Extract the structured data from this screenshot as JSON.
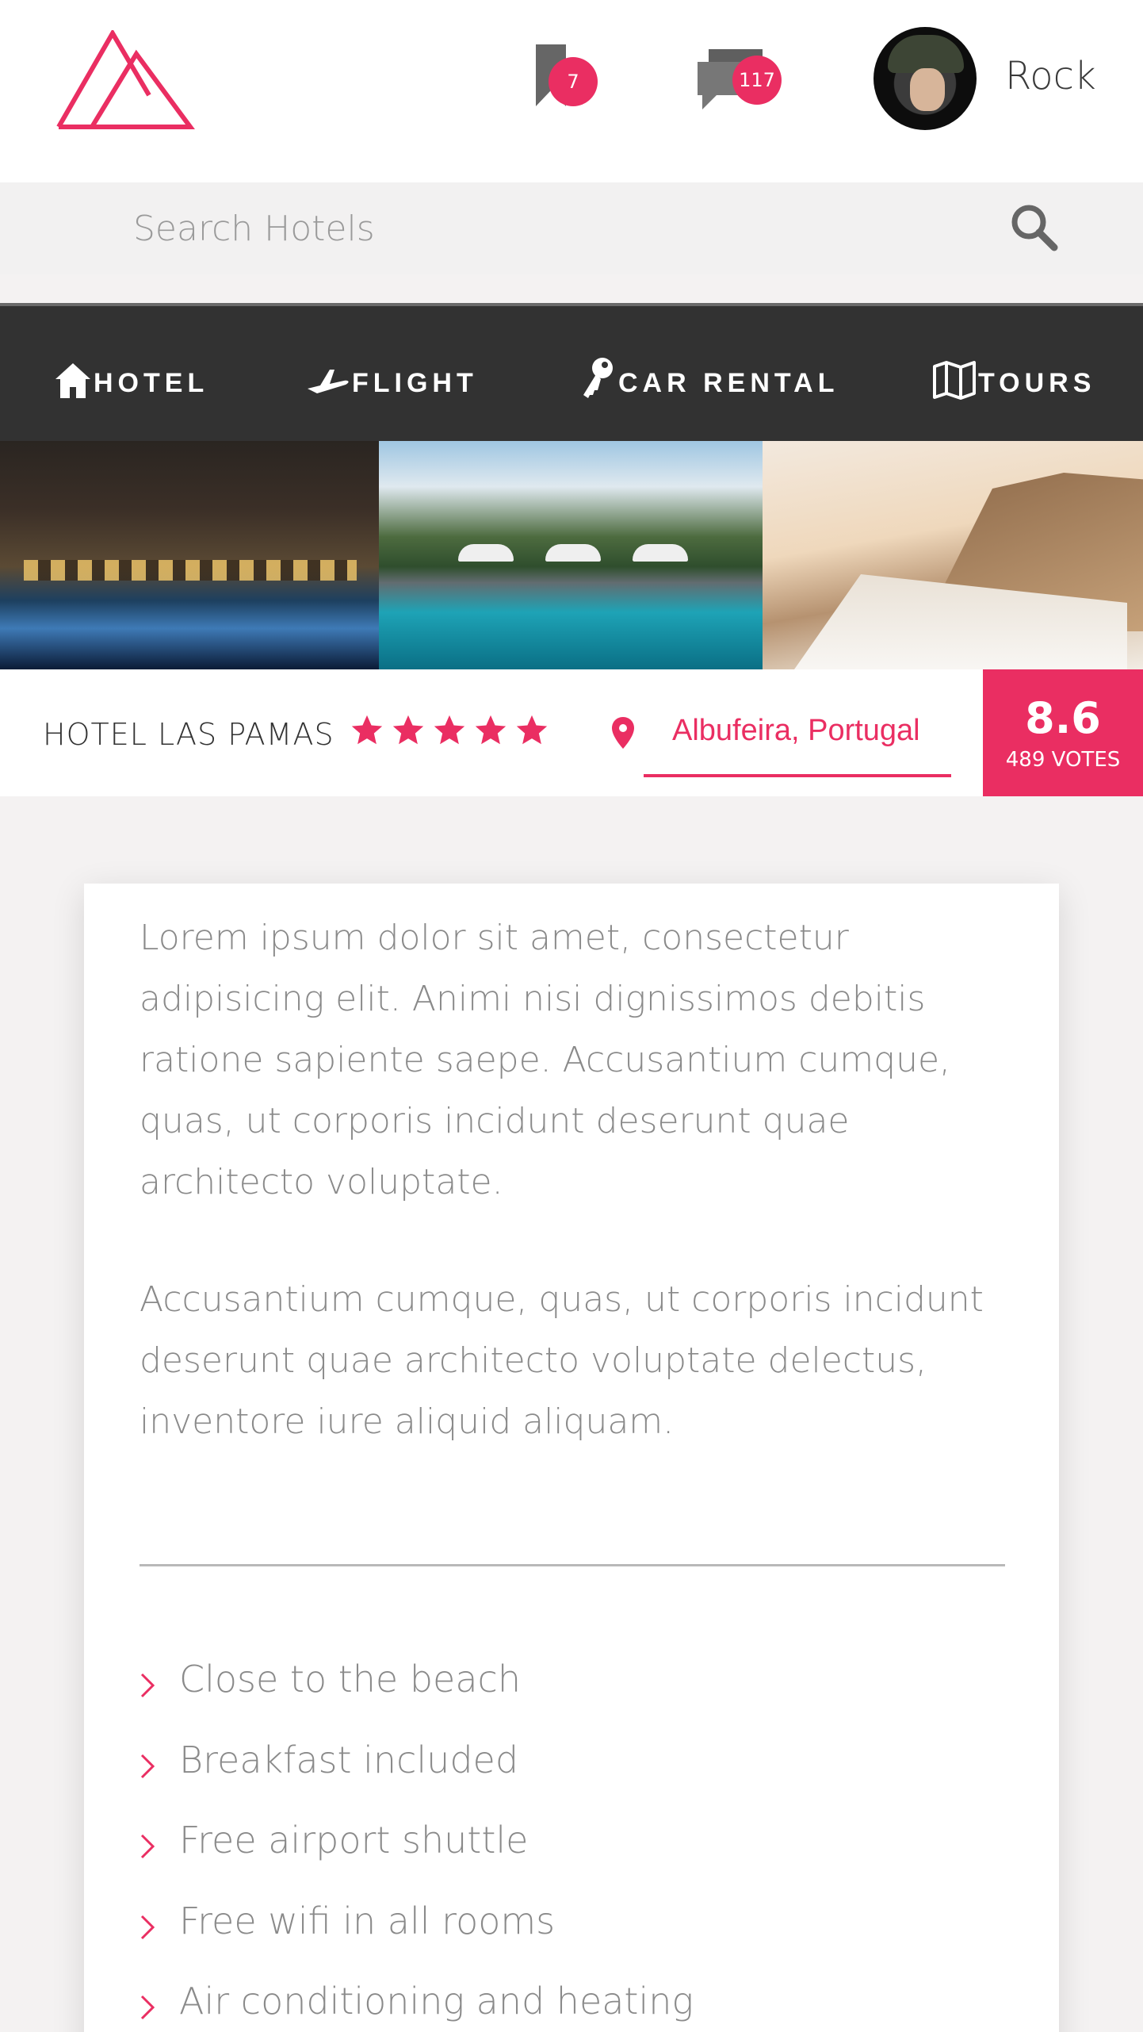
{
  "header": {
    "brand_color": "#ea2e62",
    "bookmarks_count": "7",
    "messages_count": "117",
    "username": "Rock"
  },
  "search": {
    "placeholder": "Search Hotels"
  },
  "nav": {
    "items": [
      {
        "label": "HOTEL",
        "icon": "home-icon"
      },
      {
        "label": "FLIGHT",
        "icon": "plane-icon"
      },
      {
        "label": "CAR RENTAL",
        "icon": "key-icon"
      },
      {
        "label": "TOURS",
        "icon": "map-icon"
      }
    ]
  },
  "gallery": {
    "photos": [
      "resort-pool-night",
      "hotel-pool-day",
      "seaside-terrace"
    ]
  },
  "hotel": {
    "name": "HOTEL LAS PAMAS",
    "rating_stars": 5,
    "location": "Albufeira, Portugal",
    "score": "8.6",
    "votes": "489 VOTES"
  },
  "details": {
    "paragraph1": "Lorem ipsum dolor sit amet, consectetur adipisicing elit. Animi nisi dignissimos debitis ratione sapiente saepe. Accusantium cumque, quas, ut corporis incidunt deserunt quae architecto voluptate.",
    "paragraph2": "Accusantium cumque, quas, ut corporis incidunt deserunt quae architecto voluptate delectus, inventore iure aliquid aliquam.",
    "features": [
      "Close to the beach",
      "Breakfast included",
      "Free airport shuttle",
      "Free wifi in all rooms",
      "Air conditioning and heating"
    ]
  }
}
